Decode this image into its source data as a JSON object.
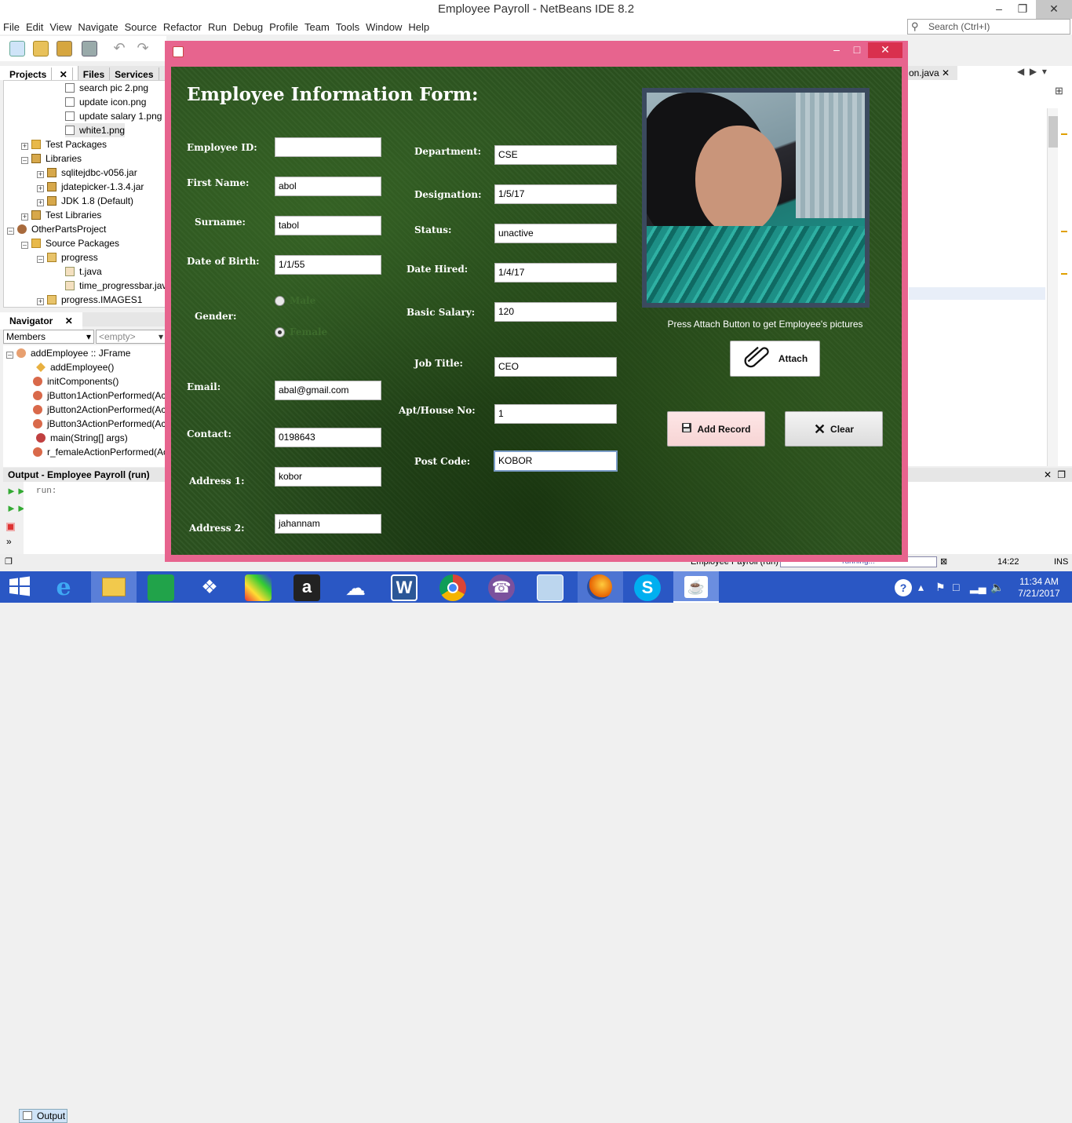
{
  "ide": {
    "title": "Employee Payroll - NetBeans IDE 8.2",
    "menu": [
      "File",
      "Edit",
      "View",
      "Navigate",
      "Source",
      "Refactor",
      "Run",
      "Debug",
      "Profile",
      "Team",
      "Tools",
      "Window",
      "Help"
    ],
    "search_placeholder": "Search (Ctrl+I)",
    "project_tabs": [
      "Projects",
      "Files",
      "Services"
    ],
    "project_tree": [
      {
        "label": "search pic 2.png",
        "type": "png"
      },
      {
        "label": "update icon.png",
        "type": "png"
      },
      {
        "label": "update salary 1.png",
        "type": "png"
      },
      {
        "label": "white1.png",
        "type": "png"
      },
      {
        "label": "Test Packages",
        "type": "folder"
      },
      {
        "label": "Libraries",
        "type": "lib"
      },
      {
        "label": "sqlitejdbc-v056.jar",
        "type": "lib"
      },
      {
        "label": "jdatepicker-1.3.4.jar",
        "type": "lib"
      },
      {
        "label": "JDK 1.8 (Default)",
        "type": "lib"
      },
      {
        "label": "Test Libraries",
        "type": "lib"
      },
      {
        "label": "OtherPartsProject",
        "type": "proj"
      },
      {
        "label": "Source Packages",
        "type": "folder"
      },
      {
        "label": "progress",
        "type": "pkg"
      },
      {
        "label": "t.java",
        "type": "java"
      },
      {
        "label": "time_progressbar.java",
        "type": "java"
      },
      {
        "label": "progress.IMAGES1",
        "type": "pkg"
      }
    ],
    "navigator_tab": "Navigator",
    "navigator_filter": "Members",
    "navigator_empty": "<empty>",
    "navigator_items": [
      "addEmployee :: JFrame",
      "addEmployee()",
      "initComponents()",
      "jButton1ActionPerformed(Acti",
      "jButton2ActionPerformed(Acti",
      "jButton3ActionPerformed(Acti",
      "main(String[] args)",
      "r_femaleActionPerformed(Acti"
    ],
    "output_title": "Output - Employee Payroll (run)",
    "output_text": "run:",
    "output_tab": "Output",
    "editor_tab": "on.java",
    "status_task": "Employee Payroll (run)",
    "status_running": "running...",
    "cursor_pos": "14:22",
    "insert_mode": "INS"
  },
  "taskbar": {
    "time": "11:34 AM",
    "date": "7/21/2017",
    "apps": [
      "start",
      "ie",
      "explorer",
      "store",
      "dropbox",
      "puzzle",
      "amazon",
      "onedrive",
      "word",
      "chrome",
      "viber",
      "box",
      "firefox",
      "skype",
      "java"
    ]
  },
  "form": {
    "title": "Employee Information Form:",
    "left_fields": [
      {
        "label": "Employee ID:",
        "value": ""
      },
      {
        "label": "First Name:",
        "value": "abol"
      },
      {
        "label": "Surname:",
        "value": "tabol"
      },
      {
        "label": "Date of Birth:",
        "value": "1/1/55"
      },
      {
        "label": "Email:",
        "value": "abal@gmail.com"
      },
      {
        "label": "Contact:",
        "value": "0198643"
      },
      {
        "label": "Address 1:",
        "value": "kobor"
      },
      {
        "label": "Address 2:",
        "value": "jahannam"
      }
    ],
    "gender": {
      "label": "Gender:",
      "options": [
        "Male",
        "Female"
      ],
      "selected": "Female"
    },
    "right_fields": [
      {
        "label": "Department:",
        "value": "CSE"
      },
      {
        "label": "Designation:",
        "value": "1/5/17"
      },
      {
        "label": "Status:",
        "value": "unactive"
      },
      {
        "label": "Date Hired:",
        "value": "1/4/17"
      },
      {
        "label": "Basic Salary:",
        "value": "120"
      },
      {
        "label": "Job Title:",
        "value": "CEO"
      },
      {
        "label": "Apt/House No:",
        "value": "1"
      },
      {
        "label": "Post Code:",
        "value": "KOBOR"
      }
    ],
    "photo_caption": "Press Attach Button to get Employee's pictures",
    "attach_label": "Attach",
    "add_label": "Add Record",
    "clear_label": "Clear"
  },
  "colors": {
    "frame_border": "#e7648e",
    "panel_green": "#2c5320",
    "taskbar": "#2a57c4",
    "add_button": "#fde6e6"
  }
}
